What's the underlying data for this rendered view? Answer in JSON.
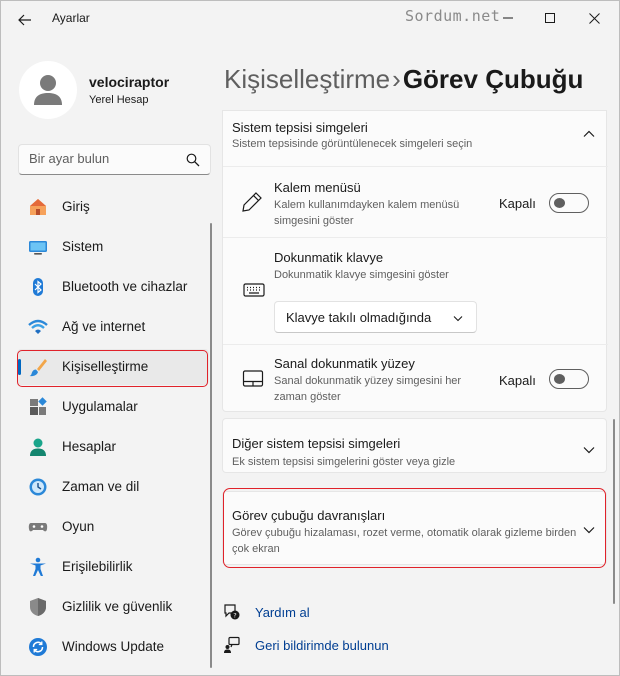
{
  "window": {
    "title": "Ayarlar",
    "watermark": "Sordum.net"
  },
  "user": {
    "name": "velociraptor",
    "account_type": "Yerel Hesap"
  },
  "search": {
    "placeholder": "Bir ayar bulun"
  },
  "nav": {
    "items": [
      {
        "label": "Giriş",
        "icon": "home-icon"
      },
      {
        "label": "Sistem",
        "icon": "monitor-icon"
      },
      {
        "label": "Bluetooth ve cihazlar",
        "icon": "bluetooth-icon"
      },
      {
        "label": "Ağ ve internet",
        "icon": "wifi-icon"
      },
      {
        "label": "Kişiselleştirme",
        "icon": "paintbrush-icon",
        "active": true
      },
      {
        "label": "Uygulamalar",
        "icon": "apps-icon"
      },
      {
        "label": "Hesaplar",
        "icon": "person-icon"
      },
      {
        "label": "Zaman ve dil",
        "icon": "clock-globe-icon"
      },
      {
        "label": "Oyun",
        "icon": "gamepad-icon"
      },
      {
        "label": "Erişilebilirlik",
        "icon": "accessibility-icon"
      },
      {
        "label": "Gizlilik ve güvenlik",
        "icon": "shield-icon"
      },
      {
        "label": "Windows Update",
        "icon": "update-icon"
      }
    ]
  },
  "breadcrumb": {
    "parent": "Kişiselleştirme",
    "separator": "›",
    "current": "Görev Çubuğu"
  },
  "tray_section": {
    "title": "Sistem tepsisi simgeleri",
    "description": "Sistem tepsisinde görüntülenecek simgeleri seçin",
    "rows": {
      "pen": {
        "title": "Kalem menüsü",
        "description": "Kalem kullanımdayken kalem menüsü simgesini göster",
        "state_label": "Kapalı",
        "on": false
      },
      "keyboard": {
        "title": "Dokunmatik klavye",
        "description": "Dokunmatik klavye simgesini göster",
        "dropdown_value": "Klavye takılı olmadığında"
      },
      "touchpad": {
        "title": "Sanal dokunmatik yüzey",
        "description": "Sanal dokunmatik yüzey simgesini her zaman göster",
        "state_label": "Kapalı",
        "on": false
      }
    }
  },
  "other_tray": {
    "title": "Diğer sistem tepsisi simgeleri",
    "description": "Ek sistem tepsisi simgelerini göster veya gizle"
  },
  "behaviors": {
    "title": "Görev çubuğu davranışları",
    "description": "Görev çubuğu hizalaması, rozet verme, otomatik olarak gizleme birden çok ekran"
  },
  "links": {
    "help": "Yardım al",
    "feedback": "Geri bildirimde bulunun"
  },
  "colors": {
    "accent": "#0067c0",
    "highlight_red": "#e0222a",
    "link": "#003e92"
  }
}
